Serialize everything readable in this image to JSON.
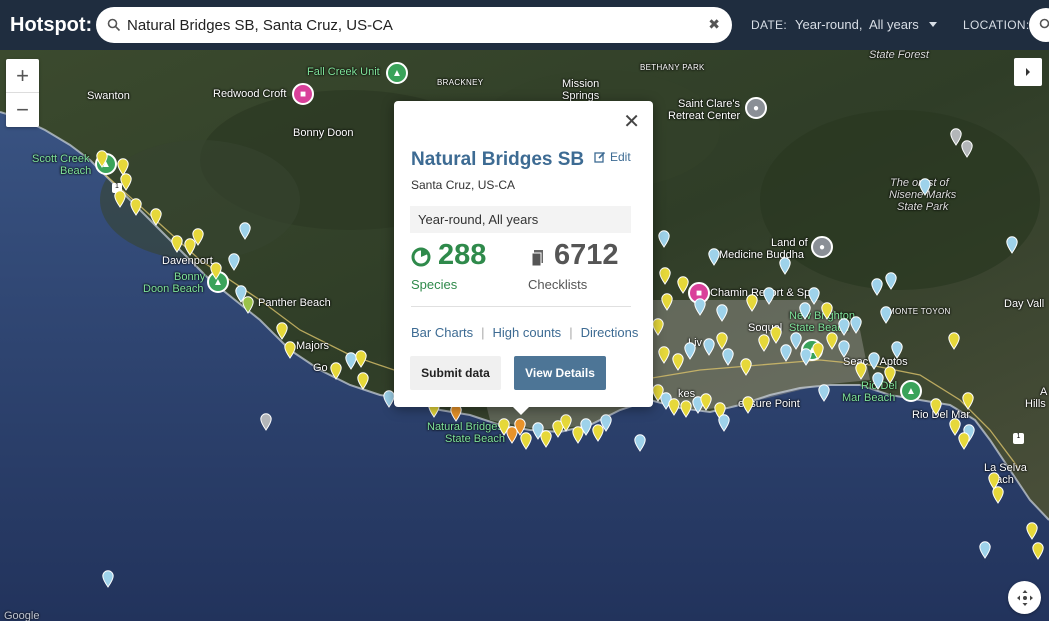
{
  "header": {
    "brand": "Hotspot:",
    "search_value": "Natural Bridges SB, Santa Cruz, US-CA",
    "date_label": "DATE:",
    "date_value": "Year-round,  All years",
    "location_label": "LOCATION:"
  },
  "map": {
    "controls": {
      "zoom_in": "+",
      "zoom_out": "−"
    },
    "labels": {
      "fall_creek": "Fall Creek Unit",
      "brackney": "BRACKNEY",
      "mission_springs_1": "Mission",
      "mission_springs_2": "Springs",
      "bethany_park": "BETHANY PARK",
      "state_forest": "State Forest",
      "swanton": "Swanton",
      "redwood_croft": "Redwood Croft",
      "bonny_doon": "Bonny Doon",
      "st_claires_1": "Saint Clare's",
      "st_claires_2": "Retreat Center",
      "scott_creek_1": "Scott Creek",
      "scott_creek_2": "Beach",
      "forest_nisene_1": "The  orest of",
      "forest_nisene_2": "Nisene Marks",
      "forest_nisene_3": "State Park",
      "davenport": "Davenport",
      "bonny_doon_beach_1": "Bonny",
      "bonny_doon_beach_2": "Doon Beach",
      "land_of_1": "Land of",
      "land_of_2": "Medicine Buddha",
      "panther_beach": "Panther Beach",
      "chaminade": "Chamin  Resort & Spa",
      "day_valley": "Day Vall",
      "new_brighton_1": "New Brighton",
      "new_brighton_2": "State Beach",
      "monte_toyon": "MONTE TOYON",
      "soquel": "Soquel",
      "majors": "Majors",
      "live_oak": "Liv",
      "seacliff": "Seac  ff Aptos",
      "gordo": "Go",
      "rio_del_mar_beach_1": "Rio Del",
      "rio_del_mar_beach_2": "Mar Beach",
      "pleasure_point": "  easure Point",
      "rio_del_mar": "Rio Del Mar",
      "aptos_hills_1": "A",
      "aptos_hills_2": "Hills",
      "natural_bridges_1": "Natural Bridges",
      "natural_bridges_2": "State Beach",
      "kes": "kes",
      "la_selva_1": "La Selva",
      "la_selva_2": "  each",
      "google": "Google"
    },
    "highway_shields": [
      "1",
      "1"
    ]
  },
  "popup": {
    "title": "Natural Bridges SB",
    "edit_label": "Edit",
    "subtitle": "Santa Cruz, US-CA",
    "dates": "Year-round, All years",
    "species_count": "288",
    "species_label": "Species",
    "checklists_count": "6712",
    "checklists_label": "Checklists",
    "links": [
      "Bar Charts",
      "High counts",
      "Directions"
    ],
    "submit_label": "Submit data",
    "view_label": "View Details"
  },
  "colors": {
    "header_bg": "#1f2d3f",
    "title_blue": "#3d6b93",
    "species_green": "#2f8a4b",
    "view_button": "#4d7596",
    "ocean": "#2a3d6e"
  }
}
